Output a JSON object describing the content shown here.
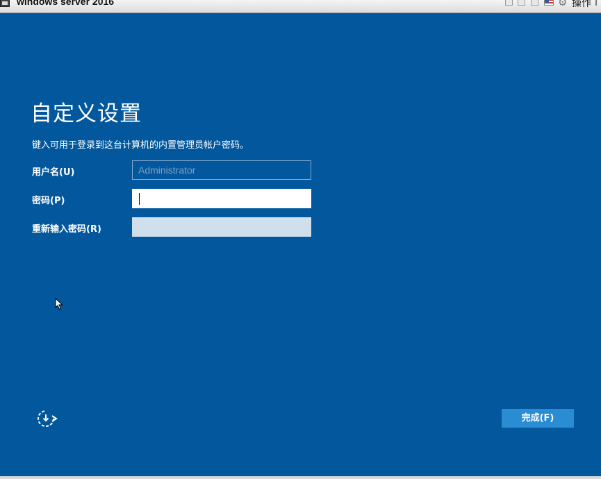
{
  "window": {
    "title": "windows server 2016",
    "actions_label": "操作"
  },
  "page": {
    "title": "自定义设置",
    "instruction": "键入可用于登录到这台计算机的内置管理员帐户密码。"
  },
  "form": {
    "username_label": "用户名(U)",
    "username_value": "Administrator",
    "password_label": "密码(P)",
    "password_value": "",
    "reenter_label": "重新输入密码(R)",
    "reenter_value": ""
  },
  "footer": {
    "finish_label": "完成(F)",
    "ease_of_access_icon": "ease-of-access-icon"
  },
  "colors": {
    "background": "#03589d",
    "button": "#2a8dd4",
    "text": "#ffffff"
  }
}
